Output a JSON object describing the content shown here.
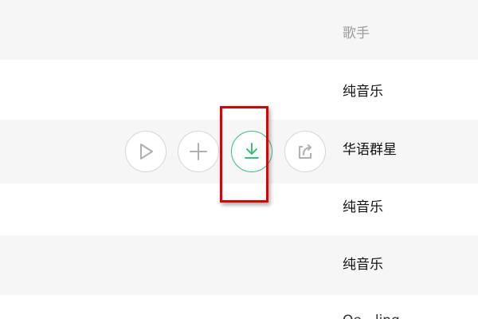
{
  "list": {
    "header": "歌手",
    "rows": [
      {
        "artist": "纯音乐"
      },
      {
        "artist": "华语群星"
      },
      {
        "artist": "纯音乐"
      },
      {
        "artist": "纯音乐"
      },
      {
        "artist": "Oe…ling"
      }
    ]
  },
  "actions": [
    {
      "name": "play",
      "icon": "play-icon"
    },
    {
      "name": "add",
      "icon": "plus-icon"
    },
    {
      "name": "download",
      "icon": "download-icon"
    },
    {
      "name": "share",
      "icon": "share-icon"
    }
  ],
  "colors": {
    "accent_green": "#31c27c",
    "highlight_red": "#e00000",
    "icon_gray": "#b0b0b0",
    "row_alt": "#f6f6f6"
  }
}
